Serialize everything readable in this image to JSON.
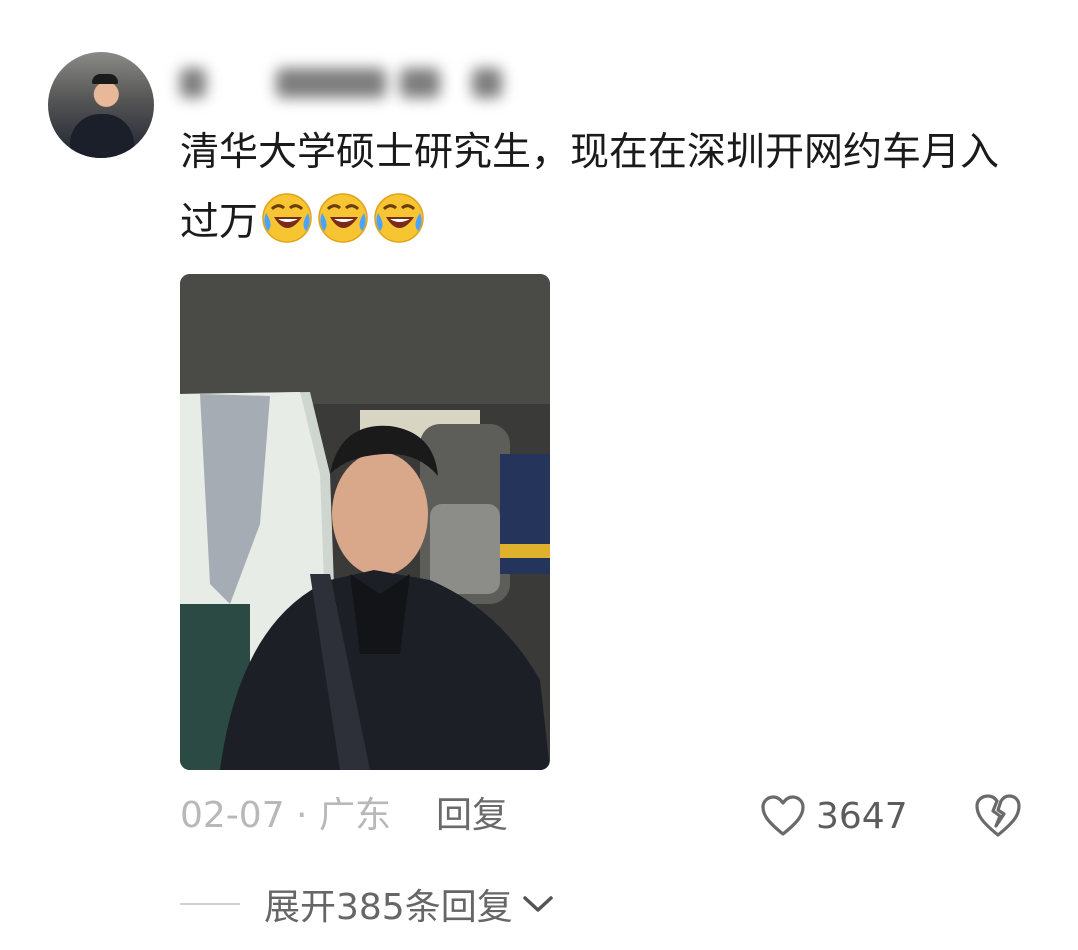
{
  "comment": {
    "text": "清华大学硕士研究生，现在在深圳开网约车月入过万",
    "emojis": [
      "laugh-cry-icon",
      "laugh-cry-icon",
      "laugh-cry-icon"
    ]
  },
  "meta": {
    "date": "02-07",
    "separator": " · ",
    "location": "广东",
    "reply_label": "回复"
  },
  "actions": {
    "like_icon": "heart-outline-icon",
    "like_count": "3647",
    "dislike_icon": "broken-heart-icon"
  },
  "replies": {
    "expand_label": "展开385条回复",
    "expand_icon": "chevron-down-icon"
  },
  "colors": {
    "text": "#1a1a1a",
    "meta": "#b8b8b8",
    "action": "#5c5c5c"
  }
}
